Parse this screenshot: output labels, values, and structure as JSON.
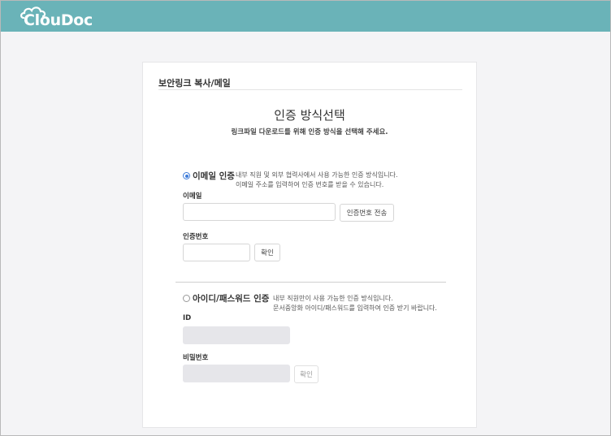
{
  "app": {
    "logo_text": "ClouDoc"
  },
  "card": {
    "title": "보안링크 복사/메일",
    "heading": "인증 방식선택",
    "subheading": "링크파일 다운로드를 위해 인증 방식을 선택해 주세요."
  },
  "email_auth": {
    "option_label": "이메일 인증",
    "selected": true,
    "desc_line1": "내부 직원 및 외부 협력사에서 사용 가능한 인증 방식입니다.",
    "desc_line2": "이메일 주소를 입력하여 인증 번호를 받을 수 있습니다.",
    "email_label": "이메일",
    "email_value": "",
    "send_button": "인증번호 전송",
    "code_label": "인증번호",
    "code_value": "",
    "confirm_button": "확인"
  },
  "id_auth": {
    "option_label": "아이디/패스워드 인증",
    "selected": false,
    "desc_line1": "내부 직원만이 사용 가능한 인증 방식입니다.",
    "desc_line2": "문서중앙화 아이디/패스워드를 입력하여 인증 받기 바랍니다.",
    "id_label": "ID",
    "id_value": "",
    "password_label": "비밀번호",
    "password_value": "",
    "confirm_button": "확인"
  },
  "colors": {
    "header": "#6ab3b8",
    "radio_active": "#3d7bd9",
    "page_background": "#f4f4f6"
  }
}
